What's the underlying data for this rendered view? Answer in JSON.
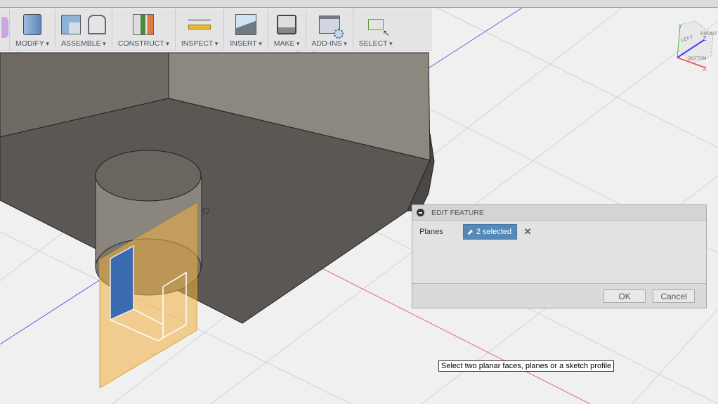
{
  "toolbar": {
    "groups": [
      {
        "label": "MODIFY",
        "icon": "press-pull-icon"
      },
      {
        "label": "ASSEMBLE",
        "icon": "new-component-icon"
      },
      {
        "label": "CONSTRUCT",
        "icon": "midplane-icon"
      },
      {
        "label": "INSPECT",
        "icon": "measure-icon"
      },
      {
        "label": "INSERT",
        "icon": "insert-image-icon"
      },
      {
        "label": "MAKE",
        "icon": "3d-print-icon"
      },
      {
        "label": "ADD-INS",
        "icon": "scripts-icon"
      },
      {
        "label": "SELECT",
        "icon": "select-window-icon"
      }
    ]
  },
  "viewcube": {
    "faces": [
      "LEFT",
      "FRONT",
      "BOTTOM"
    ],
    "axes": {
      "x": "X",
      "y": "Y",
      "z": "Z"
    }
  },
  "dialog": {
    "title": "EDIT FEATURE",
    "field_label": "Planes",
    "selection": "2 selected",
    "clear": "✕",
    "ok": "OK",
    "cancel": "Cancel"
  },
  "tooltip": "Select two planar faces, planes or a sketch profile",
  "colors": {
    "selection": "#5589b8",
    "x_axis": "#e05050",
    "z_axis": "#4a4ae0",
    "plane": "#f0b040"
  }
}
